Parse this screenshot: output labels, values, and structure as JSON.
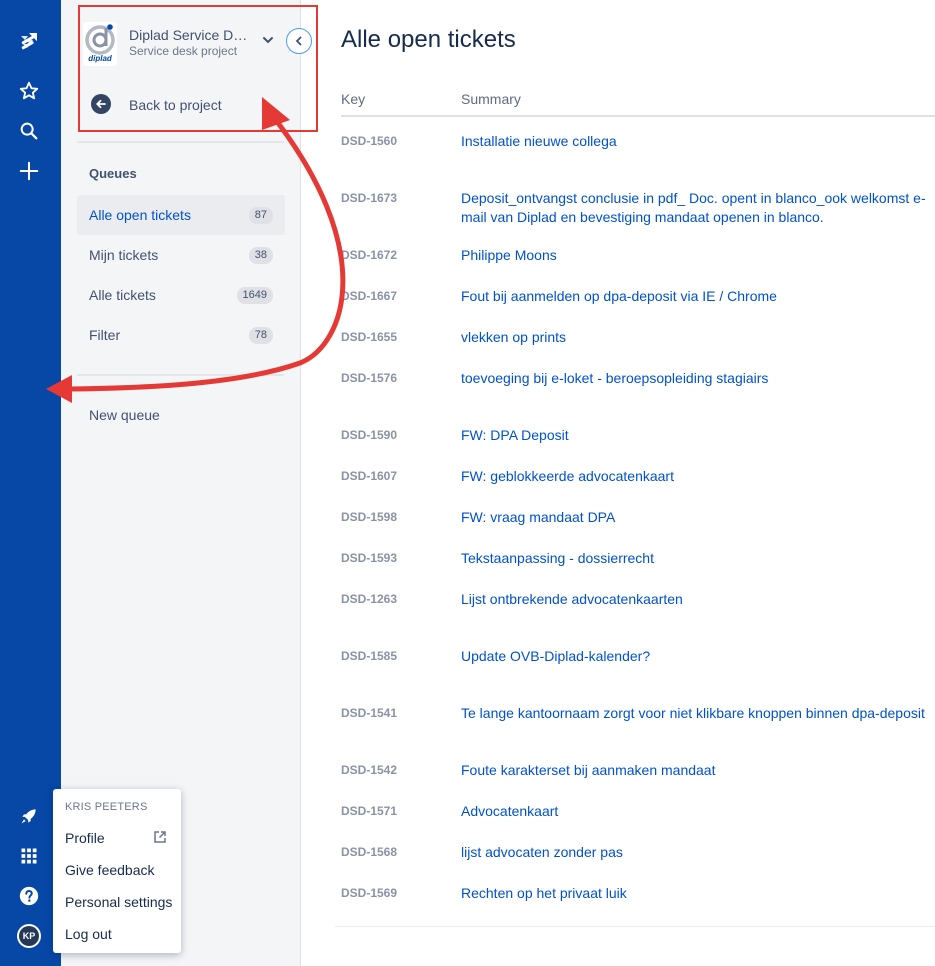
{
  "global_nav": {
    "icons": [
      "jira-logo-icon",
      "star-icon",
      "search-icon",
      "plus-icon",
      "rocket-icon",
      "app-switcher-icon",
      "help-icon"
    ],
    "avatar_initials": "KP",
    "colors": {
      "background": "#0747a6"
    }
  },
  "sidebar": {
    "project_name": "Diplad Service Desk",
    "project_type": "Service desk project",
    "logo_text": "diplad",
    "back_label": "Back to project",
    "queues_heading": "Queues",
    "queues": [
      {
        "label": "Alle open tickets",
        "count": "87",
        "active": true
      },
      {
        "label": "Mijn tickets",
        "count": "38",
        "active": false
      },
      {
        "label": "Alle tickets",
        "count": "1649",
        "active": false
      },
      {
        "label": "Filter",
        "count": "78",
        "active": false
      }
    ],
    "new_queue_label": "New queue"
  },
  "main": {
    "title": "Alle open tickets",
    "columns": {
      "key": "Key",
      "summary": "Summary"
    },
    "tickets": [
      {
        "key": "DSD-1560",
        "summary": "Installatie nieuwe collega"
      },
      {
        "key": "DSD-1673",
        "summary": "Deposit_ontvangst conclusie in pdf_ Doc. opent in blanco_ook welkomst e-mail van Diplad en bevestiging mandaat openen in blanco."
      },
      {
        "key": "DSD-1672",
        "summary": "Philippe Moons"
      },
      {
        "key": "DSD-1667",
        "summary": "Fout bij aanmelden op dpa-deposit via IE / Chrome"
      },
      {
        "key": "DSD-1655",
        "summary": "vlekken op prints"
      },
      {
        "key": "DSD-1576",
        "summary": "toevoeging bij e-loket - beroepsopleiding stagiairs"
      },
      {
        "key": "DSD-1590",
        "summary": "FW: DPA Deposit"
      },
      {
        "key": "DSD-1607",
        "summary": "FW: geblokkeerde advocatenkaart"
      },
      {
        "key": "DSD-1598",
        "summary": "FW: vraag mandaat DPA"
      },
      {
        "key": "DSD-1593",
        "summary": "Tekstaanpassing - dossierrecht"
      },
      {
        "key": "DSD-1263",
        "summary": "Lijst ontbrekende advocatenkaarten"
      },
      {
        "key": "DSD-1585",
        "summary": "Update OVB-Diplad-kalender?"
      },
      {
        "key": "DSD-1541",
        "summary": "Te lange kantoornaam zorgt voor niet klikbare knoppen binnen dpa-deposit"
      },
      {
        "key": "DSD-1542",
        "summary": "Foute karakterset bij aanmaken mandaat"
      },
      {
        "key": "DSD-1571",
        "summary": "Advocatenkaart"
      },
      {
        "key": "DSD-1568",
        "summary": "lijst advocaten zonder pas"
      },
      {
        "key": "DSD-1569",
        "summary": "Rechten op het privaat luik"
      }
    ]
  },
  "profile_menu": {
    "user": "KRIS PEETERS",
    "items": [
      "Profile",
      "Give feedback",
      "Personal settings",
      "Log out"
    ]
  },
  "annotation": {
    "color": "#e53935"
  }
}
